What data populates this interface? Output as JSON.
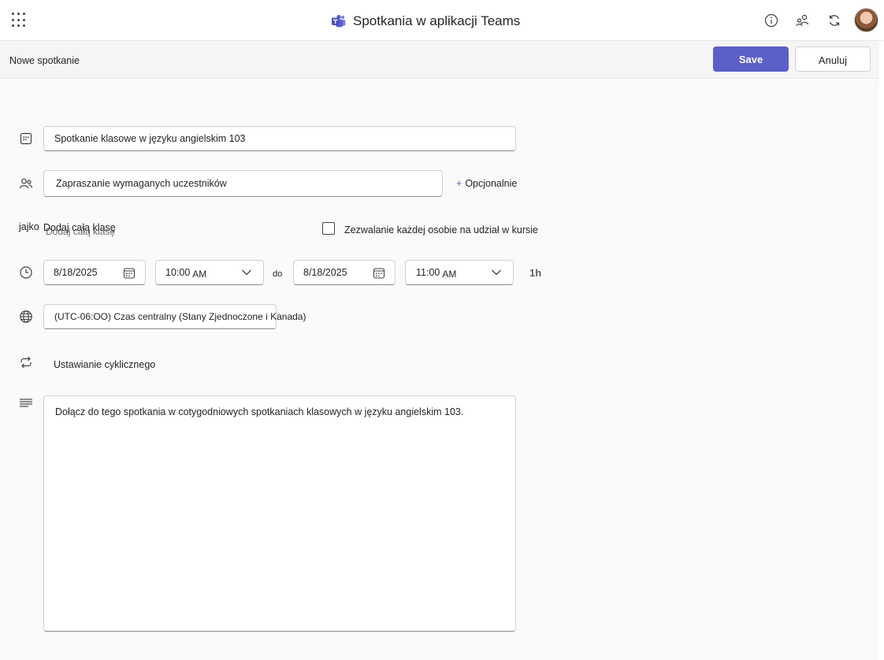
{
  "app": {
    "title": "Spotkania w aplikacji Teams",
    "icons": [
      "app-launcher-icon",
      "teams-logo-icon",
      "info-icon",
      "people-settings-icon",
      "refresh-icon",
      "user-avatar"
    ]
  },
  "command_bar": {
    "page_title": "Nowe spotkanie",
    "save_label": "Save",
    "cancel_label": "Anuluj"
  },
  "form": {
    "title_value": "Spotkanie klasowe w języku angielskim 103",
    "attendees_placeholder": "Zapraszanie wymaganych uczestników",
    "optional_label": "Opcjonalnie",
    "as_label": "jajko",
    "add_class_label": "Dodaj całą klasę",
    "add_class_ghost": "Dodaj całą klasę",
    "allow_label": "Zezwalanie każdej osobie na udział w kursie",
    "start_date": "8/18/2025",
    "start_time": "10:00",
    "start_ampm": "AM",
    "to_label": "do",
    "end_date": "8/18/2025",
    "end_time": "11:00",
    "end_ampm": "AM",
    "duration": "1h",
    "timezone": "(UTC-06:OO) Czas centralny (Stany Zjednoczone i Kanada)",
    "recurrence_label": "Ustawianie cyklicznego",
    "description": "Dołącz do tego spotkania w cotygodniowych spotkaniach klasowych w języku angielskim 103."
  },
  "colors": {
    "accent": "#5b5fc7",
    "text": "#242424",
    "background": "#fafafa"
  }
}
